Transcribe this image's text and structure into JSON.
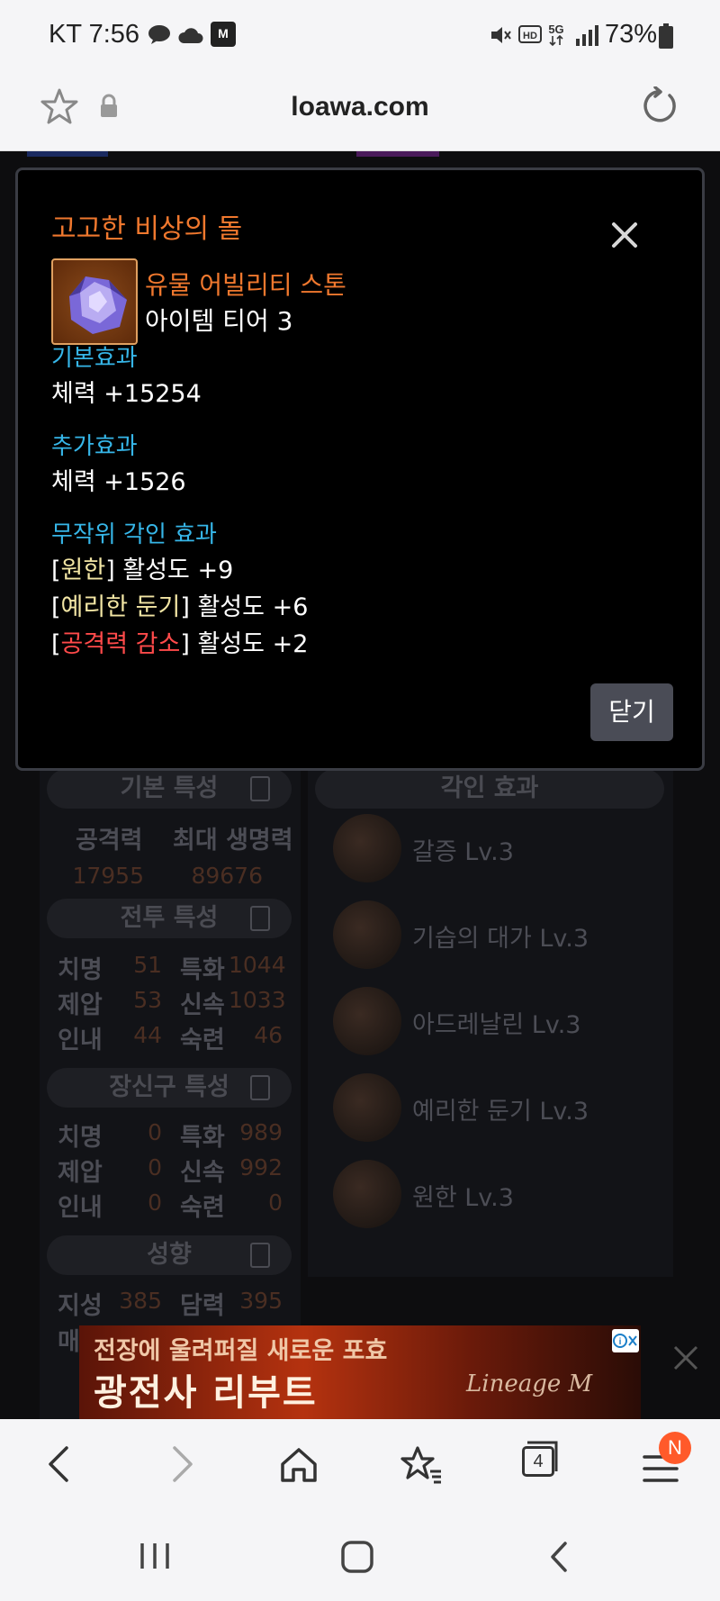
{
  "status_bar": {
    "carrier_time": "KT 7:56",
    "battery": "73%",
    "icons": [
      "talk-icon",
      "cloud-icon",
      "mstock-icon",
      "mute-icon",
      "hd-icon",
      "5g-icon",
      "signal-icon",
      "battery-icon"
    ]
  },
  "url_bar": {
    "url": "loawa.com",
    "icons": [
      "star-icon",
      "lock-icon",
      "reload-icon"
    ]
  },
  "background": {
    "pills": {
      "basic": "기본 특성",
      "engraving": "각인 효과",
      "combat": "전투 특성",
      "accessory": "장신구 특성",
      "tendency": "성향"
    },
    "basic_stats": {
      "attack_label": "공격력",
      "hp_label": "최대 생명력",
      "attack": "17955",
      "hp": "89676"
    },
    "combat_stats": [
      {
        "l1": "치명",
        "v1": "51",
        "l2": "특화",
        "v2": "1044"
      },
      {
        "l1": "제압",
        "v1": "53",
        "l2": "신속",
        "v2": "1033"
      },
      {
        "l1": "인내",
        "v1": "44",
        "l2": "숙련",
        "v2": "46"
      }
    ],
    "accessory_stats": [
      {
        "l1": "치명",
        "v1": "0",
        "l2": "특화",
        "v2": "989"
      },
      {
        "l1": "제압",
        "v1": "0",
        "l2": "신속",
        "v2": "992"
      },
      {
        "l1": "인내",
        "v1": "0",
        "l2": "숙련",
        "v2": "0"
      }
    ],
    "tendency_stats": {
      "l1": "지성",
      "v1": "385",
      "l2": "담력",
      "v2": "395",
      "l3": "매"
    },
    "engravings": [
      "갈증 Lv.3",
      "기습의 대가 Lv.3",
      "아드레날린 Lv.3",
      "예리한 둔기 Lv.3",
      "원한 Lv.3"
    ]
  },
  "ad": {
    "line1": "전장에 울려퍼질 새로운 포효",
    "line2": "광전사 리부트",
    "brand": "Lineage M"
  },
  "modal": {
    "title": "고고한 비상의 돌",
    "grade": "유물 어빌리티 스톤",
    "tier": "아이템 티어 3",
    "base_label": "기본효과",
    "base_value": "체력 +15254",
    "extra_label": "추가효과",
    "extra_value": "체력 +1526",
    "random_label": "무작위 각인 효과",
    "engravings": [
      {
        "name": "원한",
        "value": "활성도 +9",
        "color": "#f2e5a4"
      },
      {
        "name": "예리한 둔기",
        "value": "활성도 +6",
        "color": "#f2e5a4"
      },
      {
        "name": "공격력 감소",
        "value": "활성도 +2",
        "color": "#ff4a4a"
      }
    ],
    "close_button": "닫기"
  },
  "nav_bar": {
    "tabs_count": "4",
    "badge": "N",
    "icons": [
      "back-icon",
      "forward-icon",
      "home-icon",
      "bookmarks-icon",
      "tabs-icon",
      "menu-icon"
    ]
  },
  "system_nav": {
    "icons": [
      "recents-icon",
      "home-icon",
      "back-icon"
    ]
  }
}
